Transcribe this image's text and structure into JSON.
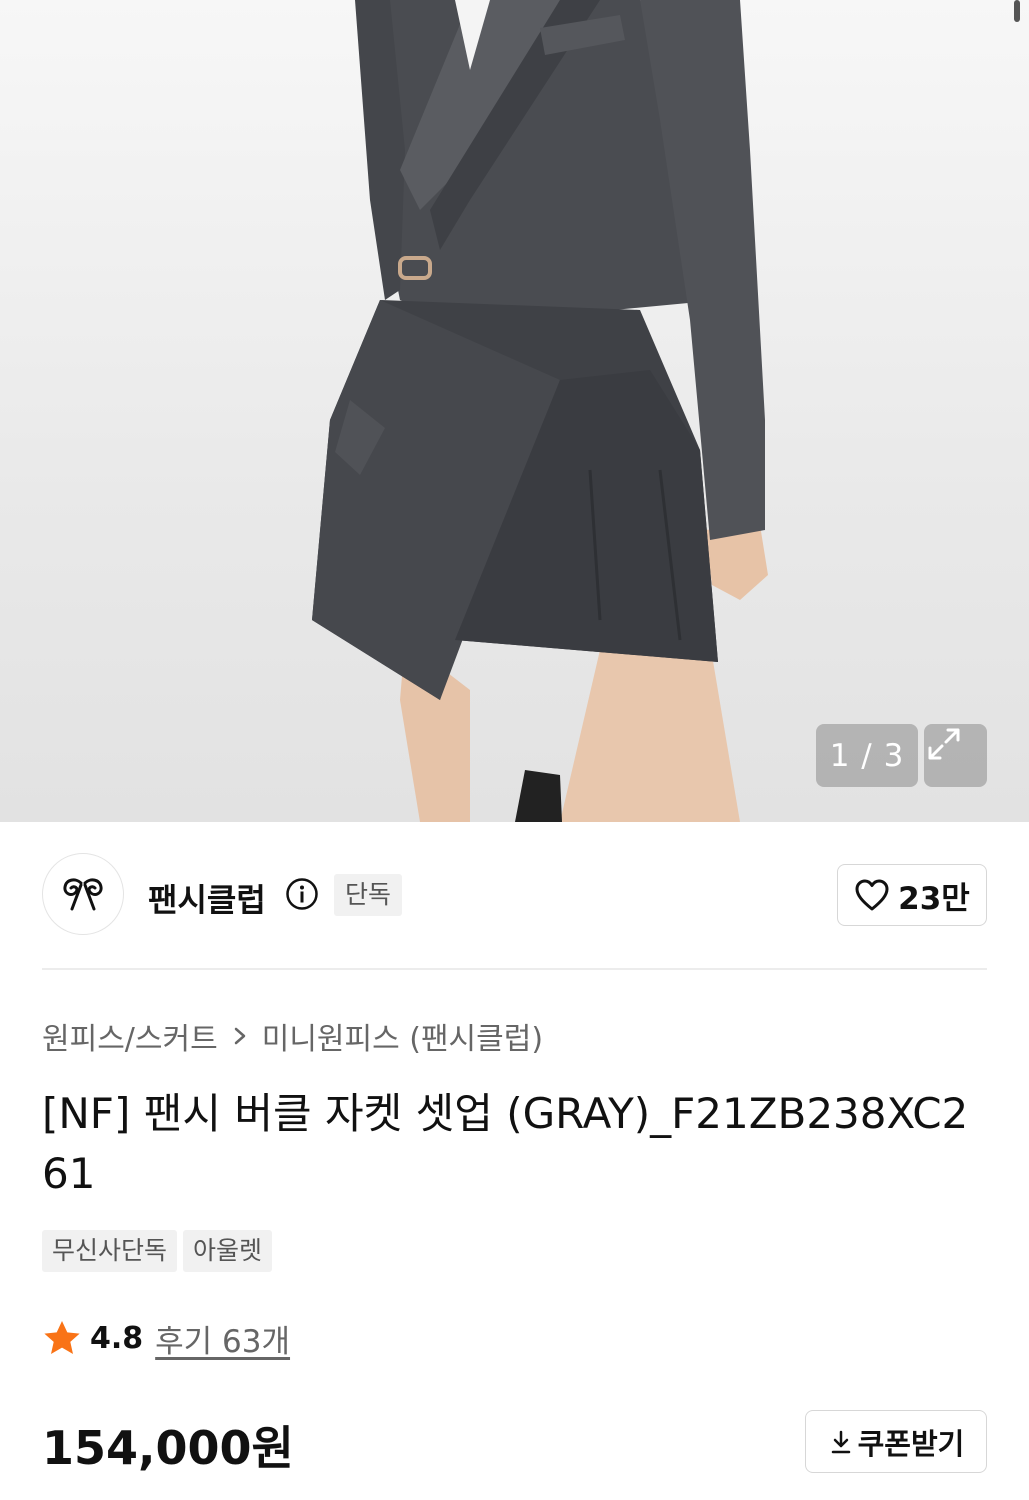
{
  "gallery": {
    "current": 1,
    "total": 3,
    "pager_text": "1 / 3"
  },
  "brand": {
    "name": "팬시클럽",
    "badge": "단독"
  },
  "like": {
    "count_label": "23만"
  },
  "breadcrumb": {
    "category": "원피스/스커트",
    "subcategory": "미니원피스 (팬시클럽)"
  },
  "product": {
    "title": "[NF] 팬시 버클 자켓 셋업 (GRAY)_F21ZB238XC261",
    "tags": [
      "무신사단독",
      "아울렛"
    ],
    "rating": "4.8",
    "review_label": "후기 63개",
    "price": "154,000원"
  },
  "actions": {
    "coupon_label": "쿠폰받기"
  },
  "colors": {
    "star": "#f97316",
    "text": "#111111",
    "muted": "#666666"
  }
}
